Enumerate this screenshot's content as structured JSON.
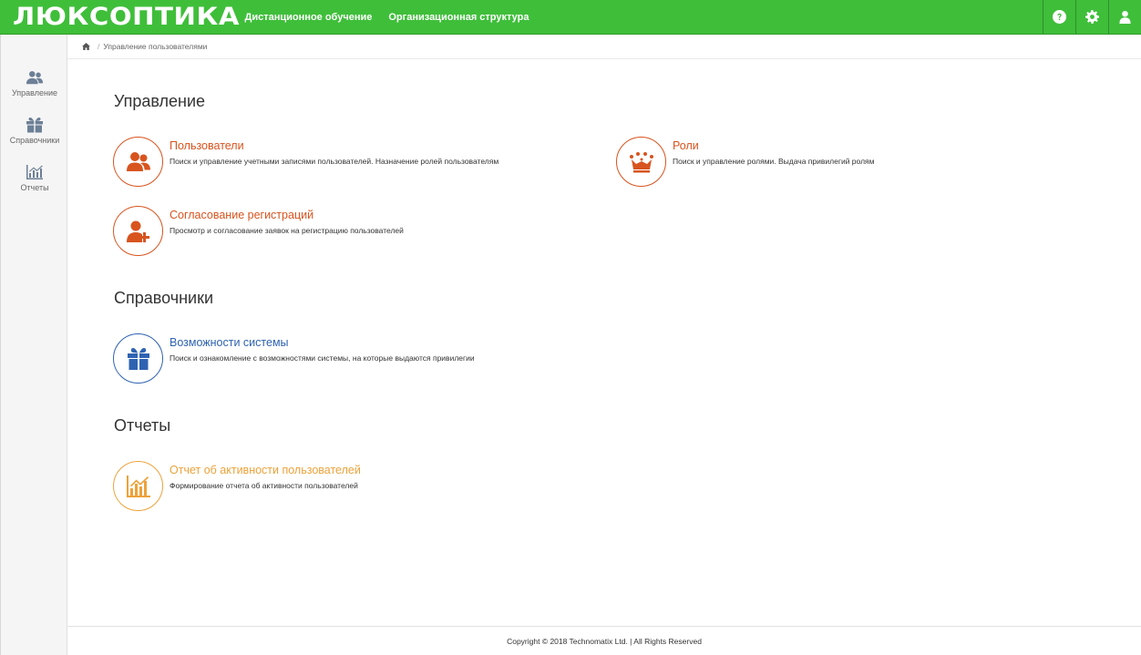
{
  "brand": "ЛЮКСОПТИКА",
  "topnav": [
    "Дистанционное обучение",
    "Организационная структура"
  ],
  "top_icons": [
    "help-icon",
    "gear-icon",
    "user-icon"
  ],
  "sidebar": [
    {
      "label": "Управление",
      "icon": "users-icon"
    },
    {
      "label": "Справочники",
      "icon": "gift-icon"
    },
    {
      "label": "Отчеты",
      "icon": "chart-icon"
    }
  ],
  "breadcrumb": {
    "home_icon": "home-icon",
    "current": "Управление пользователями"
  },
  "sections": [
    {
      "title": "Управление",
      "cards": [
        {
          "title": "Пользователи",
          "desc": "Поиск и управление учетными записями пользователей. Назначение ролей пользователям",
          "icon": "users-icon",
          "color": "#d8541f"
        },
        {
          "title": "Роли",
          "desc": "Поиск и управление ролями. Выдача привилегий ролям",
          "icon": "crown-icon",
          "color": "#d8541f"
        },
        {
          "title": "Согласование регистраций",
          "desc": "Просмотр и согласование заявок на регистрацию пользователей",
          "icon": "user-add-icon",
          "color": "#d8541f"
        }
      ]
    },
    {
      "title": "Справочники",
      "cards": [
        {
          "title": "Возможности системы",
          "desc": "Поиск и ознакомление с возможностями системы, на которые выдаются привилегии",
          "icon": "gift-icon",
          "color": "#2f63b2"
        }
      ]
    },
    {
      "title": "Отчеты",
      "cards": [
        {
          "title": "Отчет об активности пользователей",
          "desc": "Формирование отчета об активности пользователей",
          "icon": "chart-icon",
          "color": "#eda23a"
        }
      ]
    }
  ],
  "footer": "Copyright © 2018 Technomatix Ltd. | All Rights Reserved",
  "colors": {
    "topbar": "#3fbe3a",
    "orange": "#d8541f",
    "blue": "#2f63b2",
    "yellow": "#eda23a"
  }
}
